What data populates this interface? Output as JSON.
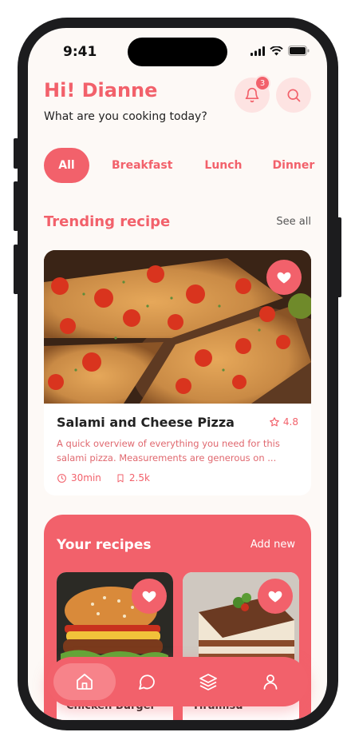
{
  "status_bar": {
    "time": "9:41"
  },
  "header": {
    "greeting": "Hi! Dianne",
    "subtitle": "What are you cooking today?",
    "notification_count": "3"
  },
  "categories": [
    {
      "label": "All",
      "active": true
    },
    {
      "label": "Breakfast",
      "active": false
    },
    {
      "label": "Lunch",
      "active": false
    },
    {
      "label": "Dinner",
      "active": false
    }
  ],
  "trending": {
    "title": "Trending recipe",
    "see_all": "See all",
    "recipe": {
      "name": "Salami and Cheese Pizza",
      "rating": "4.8",
      "description": "A quick overview of everything you need for this salami pizza. Measurements are generous on ...",
      "time": "30min",
      "saves": "2.5k"
    }
  },
  "your_recipes": {
    "title": "Your recipes",
    "add_new": "Add new",
    "items": [
      {
        "name": "Chicken Burger"
      },
      {
        "name": "Tiramisu"
      }
    ]
  },
  "tabbar": {
    "items": [
      {
        "icon": "home-icon",
        "active": true
      },
      {
        "icon": "chat-icon",
        "active": false
      },
      {
        "icon": "layers-icon",
        "active": false
      },
      {
        "icon": "profile-icon",
        "active": false
      }
    ]
  },
  "colors": {
    "accent": "#f2616b",
    "accent_light": "#fde3e2",
    "background": "#fdf9f6"
  }
}
